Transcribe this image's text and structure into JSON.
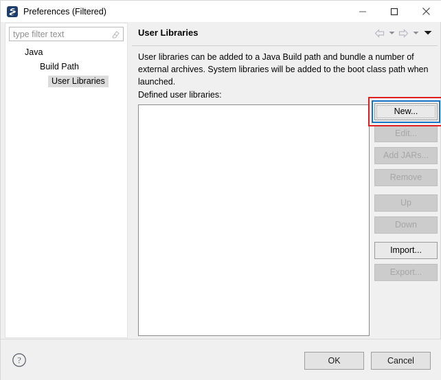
{
  "window": {
    "title": "Preferences (Filtered)",
    "icon": "eclipse-app-icon",
    "controls": {
      "minimize": "minimize-icon",
      "maximize": "maximize-icon",
      "close": "close-icon"
    }
  },
  "filter": {
    "placeholder": "type filter text",
    "value": "",
    "clear_icon": "eraser-icon"
  },
  "tree": {
    "items": [
      {
        "label": "Java",
        "level": 1,
        "selected": false
      },
      {
        "label": "Build Path",
        "level": 2,
        "selected": false
      },
      {
        "label": "User Libraries",
        "level": 3,
        "selected": true
      }
    ]
  },
  "page": {
    "title": "User Libraries",
    "description": "User libraries can be added to a Java Build path and bundle a number of external archives. System libraries will be added to the boot class path when launched.",
    "list_label": "Defined user libraries:",
    "list_items": []
  },
  "nav": {
    "back": "back-arrow-icon",
    "back_menu": "chevron-down-icon",
    "forward": "forward-arrow-icon",
    "forward_menu": "chevron-down-icon",
    "view_menu": "chevron-down-icon"
  },
  "side_buttons": [
    {
      "label": "New...",
      "enabled": true,
      "focused": true,
      "annotated": true,
      "gap_before": false
    },
    {
      "label": "Edit...",
      "enabled": false,
      "focused": false,
      "annotated": false,
      "gap_before": false
    },
    {
      "label": "Add JARs...",
      "enabled": false,
      "focused": false,
      "annotated": false,
      "gap_before": false
    },
    {
      "label": "Remove",
      "enabled": false,
      "focused": false,
      "annotated": false,
      "gap_before": false
    },
    {
      "label": "Up",
      "enabled": false,
      "focused": false,
      "annotated": false,
      "gap_before": true
    },
    {
      "label": "Down",
      "enabled": false,
      "focused": false,
      "annotated": false,
      "gap_before": false
    },
    {
      "label": "Import...",
      "enabled": true,
      "focused": false,
      "annotated": false,
      "gap_before": true
    },
    {
      "label": "Export...",
      "enabled": false,
      "focused": false,
      "annotated": false,
      "gap_before": false
    }
  ],
  "footer": {
    "help_icon": "help-question-icon",
    "ok_label": "OK",
    "cancel_label": "Cancel"
  },
  "colors": {
    "dialog_background": "#f0f0f0",
    "panel_white": "#ffffff",
    "focus_blue": "#1675c6",
    "annotation_red": "#e02020",
    "selection_gray": "#dcdcdc",
    "disabled_text": "#a6a6a6",
    "app_icon_blue": "#1e3d6b"
  }
}
